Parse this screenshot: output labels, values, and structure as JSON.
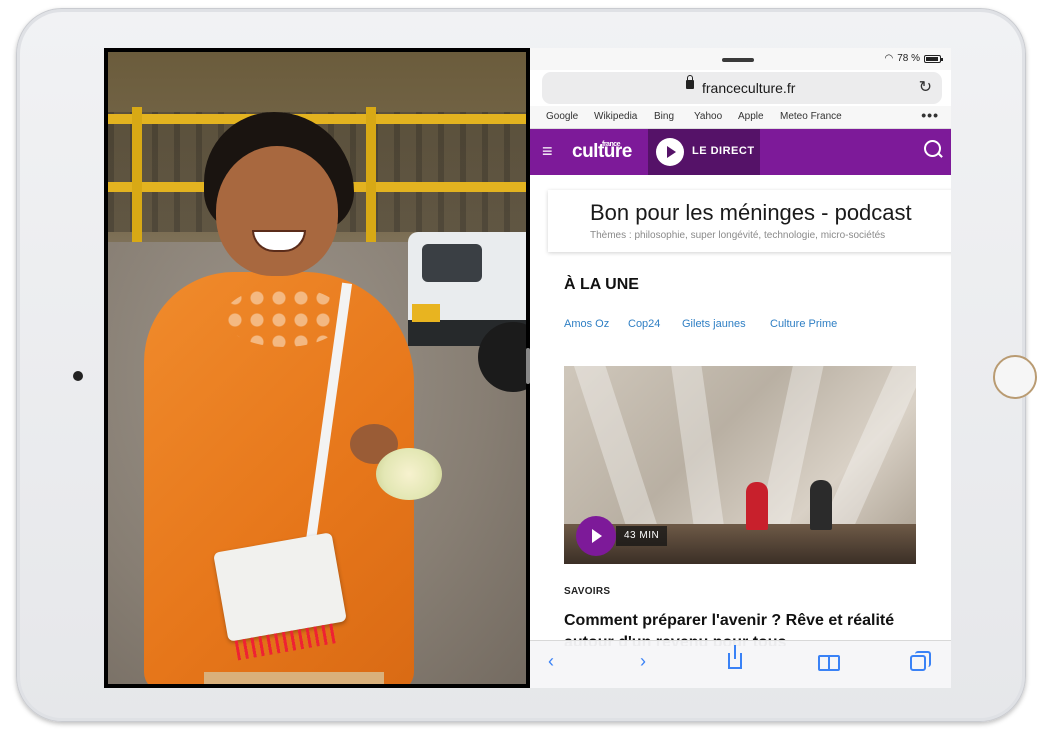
{
  "status_bar": {
    "battery": "78 %"
  },
  "browser": {
    "domain": "franceculture.fr",
    "reload_icon": "reload-icon",
    "bookmarks": [
      "Google",
      "Wikipedia",
      "Bing",
      "Yahoo",
      "Apple",
      "Meteo France"
    ],
    "more_label": "•••"
  },
  "site_header": {
    "logo_small": "france",
    "logo_main": "culture",
    "live_label": "LE DIRECT",
    "brand_color": "#7d1a99",
    "live_bg_color": "#551268"
  },
  "promo": {
    "title": "Bon pour les méninges - podcast",
    "subtitle": "Thèmes : philosophie, super longévité, technologie, micro-sociétés"
  },
  "une": {
    "title": "À LA UNE",
    "tags": [
      "Amos Oz",
      "Cop24",
      "Gilets jaunes",
      "Culture Prime"
    ]
  },
  "article": {
    "duration": "43 MIN",
    "category": "SAVOIRS",
    "headline": "Comment préparer l'avenir ? Rêve et réalité autour d'un revenu pour tous"
  },
  "toolbar": {
    "back": "‹",
    "forward": "›"
  },
  "colors": {
    "link": "#2f7fc4",
    "toolbar_accent": "#3a82f6"
  }
}
